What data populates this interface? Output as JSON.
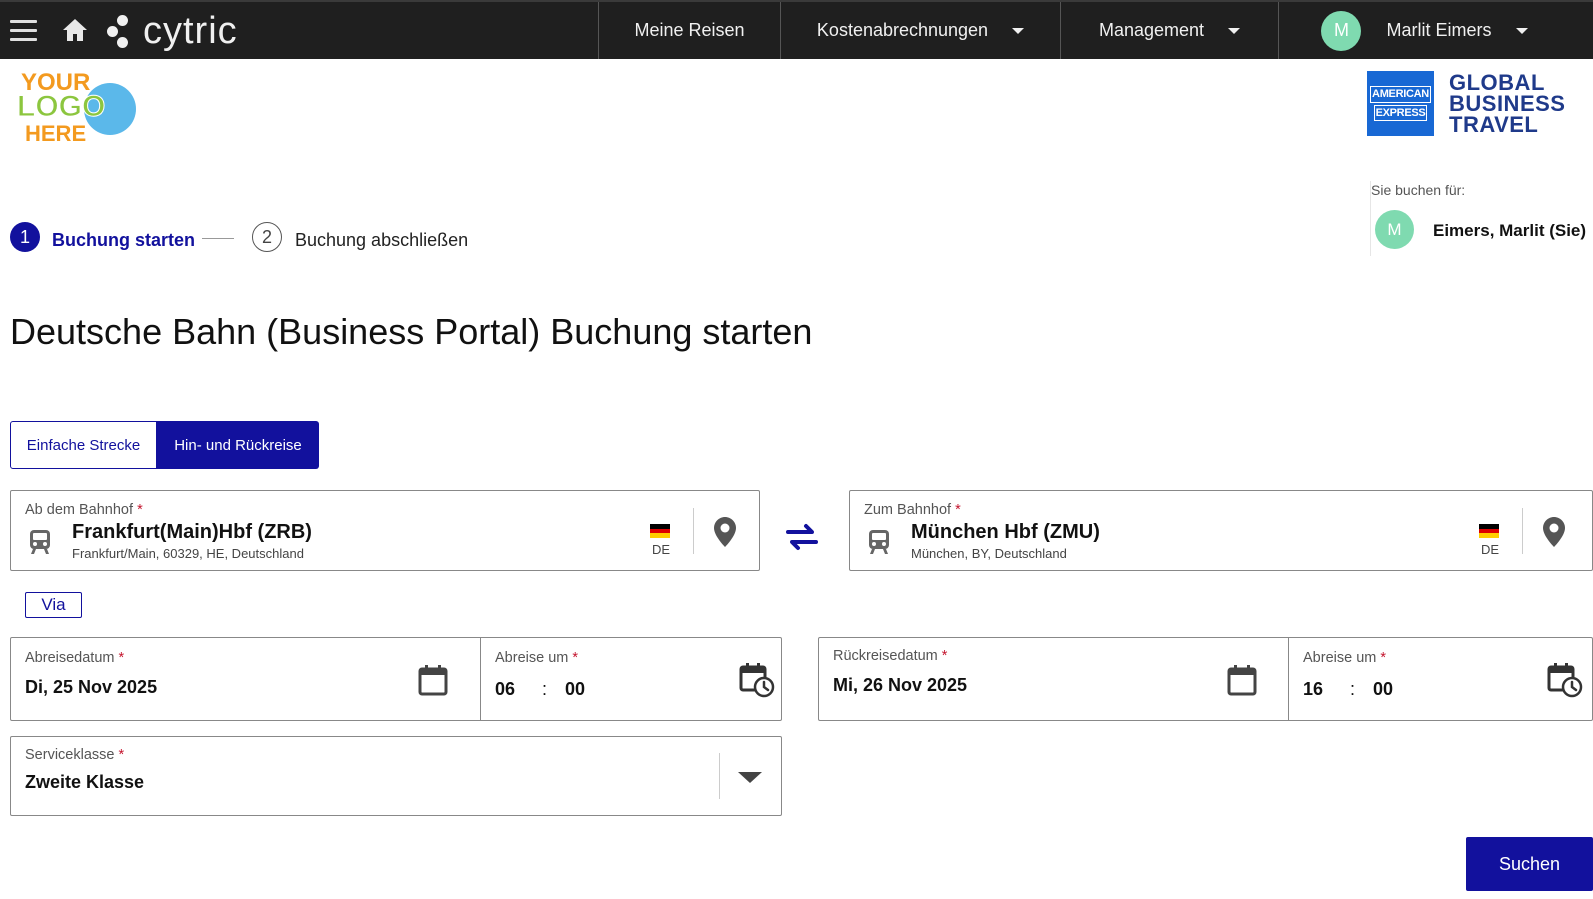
{
  "header": {
    "brand": "cytric",
    "nav": [
      {
        "label": "Meine Reisen"
      },
      {
        "label": "Kostenabrechnungen"
      },
      {
        "label": "Management"
      }
    ],
    "user": {
      "initial": "M",
      "name": "Marlit Eimers"
    }
  },
  "logos": {
    "company_logo_text": [
      "YOUR",
      "LOGO",
      "HERE"
    ],
    "amex_box": [
      "AMERICAN",
      "EXPRESS"
    ],
    "amex_text": [
      "GLOBAL",
      "BUSINESS",
      "TRAVEL"
    ]
  },
  "booking_for": {
    "label": "Sie buchen für:",
    "initial": "M",
    "name": "Eimers, Marlit (Sie)"
  },
  "stepper": {
    "step1": {
      "number": "1",
      "label": "Buchung starten"
    },
    "step2": {
      "number": "2",
      "label": "Buchung abschließen"
    }
  },
  "page_title": "Deutsche Bahn (Business Portal) Buchung starten",
  "trip_type": {
    "one_way": "Einfache Strecke",
    "round_trip": "Hin- und Rückreise",
    "selected": "round_trip"
  },
  "from": {
    "label": "Ab dem Bahnhof",
    "required_mark": "*",
    "station": "Frankfurt(Main)Hbf (ZRB)",
    "address": "Frankfurt/Main, 60329, HE, Deutschland",
    "country_code": "DE"
  },
  "to": {
    "label": "Zum Bahnhof",
    "required_mark": "*",
    "station": "München Hbf (ZMU)",
    "address": "München, BY, Deutschland",
    "country_code": "DE"
  },
  "via_label": "Via",
  "outbound": {
    "date_label": "Abreisedatum",
    "date_value": "Di, 25 Nov 2025",
    "time_label": "Abreise um",
    "hour": "06",
    "separator": ":",
    "minute": "00"
  },
  "return": {
    "date_label": "Rückreisedatum",
    "date_value": "Mi, 26 Nov 2025",
    "time_label": "Abreise um",
    "hour": "16",
    "separator": ":",
    "minute": "00"
  },
  "service_class": {
    "label": "Serviceklasse",
    "value": "Zweite Klasse"
  },
  "search_button": "Suchen",
  "colors": {
    "primary": "#12119d",
    "topbar": "#1f1f1f",
    "avatar": "#7fdab0",
    "required": "#c4152e",
    "amex_blue": "#1868d4"
  }
}
